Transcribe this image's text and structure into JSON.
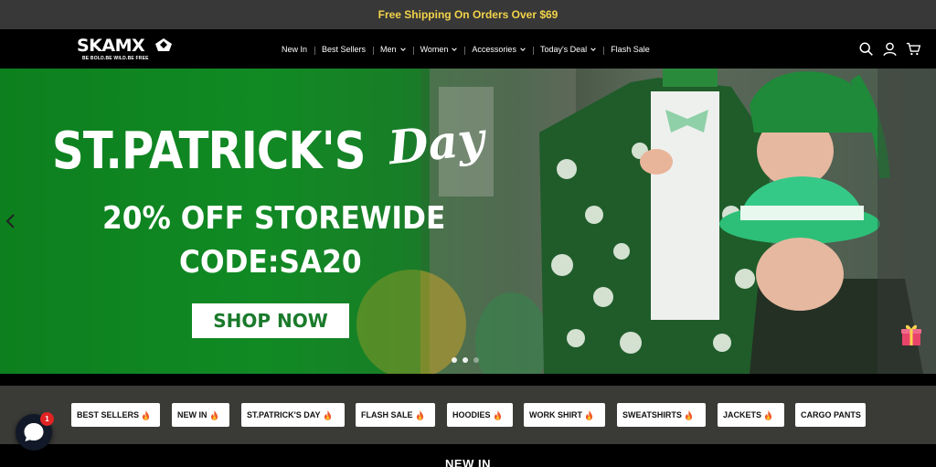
{
  "announcement": {
    "text": "Free Shipping On Orders Over $69"
  },
  "header": {
    "logo": {
      "name": "SKAMX",
      "tagline": "BE BOLD.BE WILD.BE FREE"
    },
    "nav": [
      {
        "label": "New In",
        "dropdown": false
      },
      {
        "label": "Best Sellers",
        "dropdown": false
      },
      {
        "label": "Men",
        "dropdown": true
      },
      {
        "label": "Women",
        "dropdown": true
      },
      {
        "label": "Accessories",
        "dropdown": true
      },
      {
        "label": "Today's Deal",
        "dropdown": true
      },
      {
        "label": "Flash Sale",
        "dropdown": false
      }
    ],
    "icons": [
      "search-icon",
      "account-icon",
      "cart-icon"
    ]
  },
  "hero": {
    "title": "ST.PATRICK'S",
    "title_script": "Day",
    "offer": "20% OFF STOREWIDE",
    "code": "CODE:SA20",
    "button_label": "SHOP NOW",
    "slides_total": 3,
    "active_slide": 1
  },
  "categories": [
    {
      "label": "BEST SELLERS",
      "fire": true
    },
    {
      "label": "NEW IN",
      "fire": true
    },
    {
      "label": "ST.PATRICK'S DAY",
      "fire": true
    },
    {
      "label": "FLASH SALE",
      "fire": true
    },
    {
      "label": "HOODIES",
      "fire": true
    },
    {
      "label": "WORK SHIRT",
      "fire": true
    },
    {
      "label": "SWEATSHIRTS",
      "fire": true
    },
    {
      "label": "JACKETS",
      "fire": true
    },
    {
      "label": "CARGO PANTS",
      "fire": false
    }
  ],
  "chat": {
    "badge_count": "1"
  },
  "section": {
    "title": "NEW IN"
  },
  "colors": {
    "announce_text": "#f2d34a",
    "hero_green": "#138a25",
    "button_text": "#1a7a2b",
    "badge": "#e02424"
  }
}
